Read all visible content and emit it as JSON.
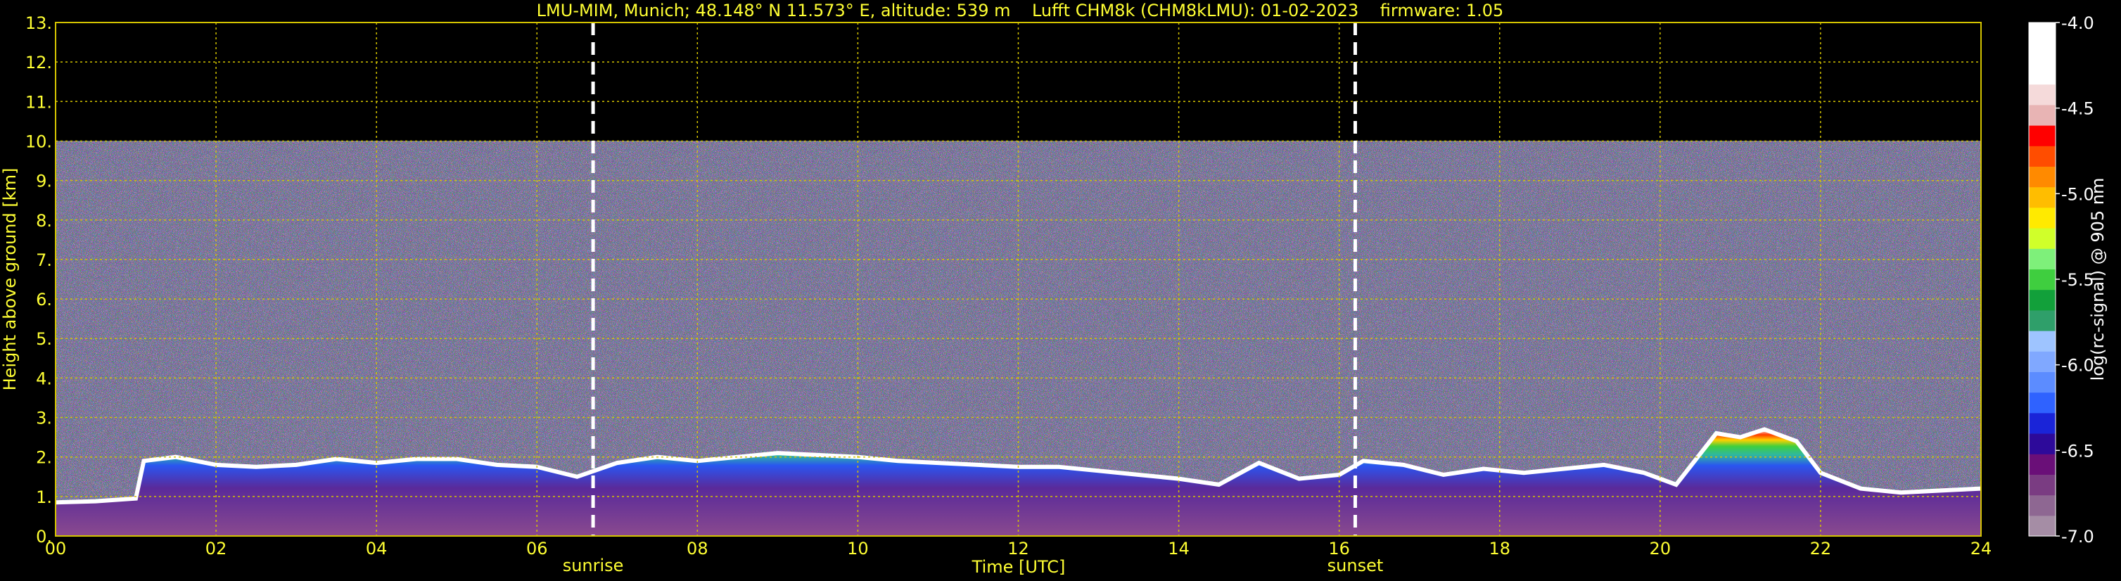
{
  "chart_data": {
    "type": "heatmap",
    "title": "LMU-MIM, Munich; 48.148° N 11.573° E, altitude: 539 m    Lufft CHM8k (CHM8kLMU): 01-02-2023    firmware: 1.05",
    "xlabel": "Time [UTC]",
    "ylabel": "Height above ground [km]",
    "xlim": [
      0,
      24
    ],
    "ylim": [
      0,
      13
    ],
    "x_ticks": [
      "00",
      "02",
      "04",
      "06",
      "08",
      "10",
      "12",
      "14",
      "16",
      "18",
      "20",
      "22",
      "24"
    ],
    "y_ticks": [
      "0.",
      "1.",
      "2.",
      "3.",
      "4.",
      "5.",
      "6.",
      "7.",
      "8.",
      "9.",
      "10.",
      "11.",
      "12.",
      "13."
    ],
    "grid": true,
    "colors": {
      "text": "#ffff33",
      "grid": "#d4c400",
      "background": "#000000"
    },
    "events": [
      {
        "label": "sunrise",
        "time": 6.7
      },
      {
        "label": "sunset",
        "time": 16.2
      }
    ],
    "signal_top_km": 10.0,
    "layer_top_km": [
      [
        0.0,
        0.85
      ],
      [
        0.5,
        0.88
      ],
      [
        1.0,
        0.95
      ],
      [
        1.1,
        1.9
      ],
      [
        1.5,
        2.0
      ],
      [
        2.0,
        1.8
      ],
      [
        2.5,
        1.75
      ],
      [
        3.0,
        1.8
      ],
      [
        3.5,
        1.95
      ],
      [
        4.0,
        1.85
      ],
      [
        4.5,
        1.95
      ],
      [
        5.0,
        1.95
      ],
      [
        5.5,
        1.8
      ],
      [
        6.0,
        1.75
      ],
      [
        6.5,
        1.5
      ],
      [
        7.0,
        1.85
      ],
      [
        7.5,
        2.0
      ],
      [
        8.0,
        1.9
      ],
      [
        8.5,
        2.0
      ],
      [
        9.0,
        2.1
      ],
      [
        9.5,
        2.05
      ],
      [
        10.0,
        2.0
      ],
      [
        10.5,
        1.9
      ],
      [
        11.0,
        1.85
      ],
      [
        11.5,
        1.8
      ],
      [
        12.0,
        1.75
      ],
      [
        12.5,
        1.75
      ],
      [
        13.0,
        1.65
      ],
      [
        13.5,
        1.55
      ],
      [
        14.0,
        1.45
      ],
      [
        14.5,
        1.3
      ],
      [
        15.0,
        1.85
      ],
      [
        15.5,
        1.45
      ],
      [
        16.0,
        1.55
      ],
      [
        16.3,
        1.9
      ],
      [
        16.8,
        1.8
      ],
      [
        17.3,
        1.55
      ],
      [
        17.8,
        1.7
      ],
      [
        18.3,
        1.6
      ],
      [
        18.8,
        1.7
      ],
      [
        19.3,
        1.8
      ],
      [
        19.8,
        1.6
      ],
      [
        20.2,
        1.3
      ],
      [
        20.7,
        2.6
      ],
      [
        21.0,
        2.5
      ],
      [
        21.3,
        2.7
      ],
      [
        21.7,
        2.4
      ],
      [
        22.0,
        1.6
      ],
      [
        22.5,
        1.2
      ],
      [
        23.0,
        1.1
      ],
      [
        23.5,
        1.15
      ],
      [
        24.0,
        1.2
      ]
    ],
    "colorbar": {
      "label": "log(rc-signal) @ 905 nm",
      "range": [
        -7.0,
        -4.0
      ],
      "ticks": [
        "-4.0",
        "-4.5",
        "-5.0",
        "-5.5",
        "-6.0",
        "-6.5",
        "-7.0"
      ],
      "colors": [
        "#a58da5",
        "#8e6792",
        "#7a3c82",
        "#6a0f78",
        "#2d0a9a",
        "#1a24d8",
        "#2f62ff",
        "#5c8cff",
        "#80a8ff",
        "#9ec4ff",
        "#2f9f6a",
        "#12a03a",
        "#3fce3f",
        "#7ef07a",
        "#d0ff2a",
        "#ffea00",
        "#ffbd00",
        "#ff8a00",
        "#ff4d00",
        "#ff0000",
        "#e8b4b4",
        "#f5dada",
        "#ffffff",
        "#ffffff",
        "#ffffff"
      ]
    }
  }
}
